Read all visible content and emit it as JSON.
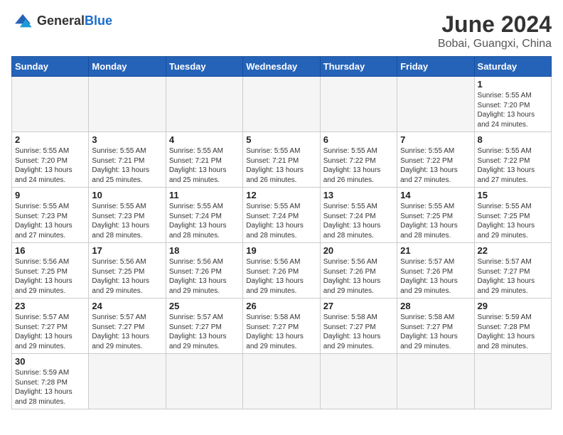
{
  "header": {
    "logo_general": "General",
    "logo_blue": "Blue",
    "month_title": "June 2024",
    "location": "Bobai, Guangxi, China"
  },
  "weekdays": [
    "Sunday",
    "Monday",
    "Tuesday",
    "Wednesday",
    "Thursday",
    "Friday",
    "Saturday"
  ],
  "days": [
    {
      "num": "",
      "sunrise": "",
      "sunset": "",
      "daylight": "",
      "empty": true
    },
    {
      "num": "",
      "sunrise": "",
      "sunset": "",
      "daylight": "",
      "empty": true
    },
    {
      "num": "",
      "sunrise": "",
      "sunset": "",
      "daylight": "",
      "empty": true
    },
    {
      "num": "",
      "sunrise": "",
      "sunset": "",
      "daylight": "",
      "empty": true
    },
    {
      "num": "",
      "sunrise": "",
      "sunset": "",
      "daylight": "",
      "empty": true
    },
    {
      "num": "",
      "sunrise": "",
      "sunset": "",
      "daylight": "",
      "empty": true
    },
    {
      "num": "1",
      "sunrise": "5:55 AM",
      "sunset": "7:20 PM",
      "daylight": "13 hours and 24 minutes.",
      "empty": false
    },
    {
      "num": "2",
      "sunrise": "5:55 AM",
      "sunset": "7:20 PM",
      "daylight": "13 hours and 24 minutes.",
      "empty": false
    },
    {
      "num": "3",
      "sunrise": "5:55 AM",
      "sunset": "7:21 PM",
      "daylight": "13 hours and 25 minutes.",
      "empty": false
    },
    {
      "num": "4",
      "sunrise": "5:55 AM",
      "sunset": "7:21 PM",
      "daylight": "13 hours and 25 minutes.",
      "empty": false
    },
    {
      "num": "5",
      "sunrise": "5:55 AM",
      "sunset": "7:21 PM",
      "daylight": "13 hours and 26 minutes.",
      "empty": false
    },
    {
      "num": "6",
      "sunrise": "5:55 AM",
      "sunset": "7:22 PM",
      "daylight": "13 hours and 26 minutes.",
      "empty": false
    },
    {
      "num": "7",
      "sunrise": "5:55 AM",
      "sunset": "7:22 PM",
      "daylight": "13 hours and 27 minutes.",
      "empty": false
    },
    {
      "num": "8",
      "sunrise": "5:55 AM",
      "sunset": "7:22 PM",
      "daylight": "13 hours and 27 minutes.",
      "empty": false
    },
    {
      "num": "9",
      "sunrise": "5:55 AM",
      "sunset": "7:23 PM",
      "daylight": "13 hours and 27 minutes.",
      "empty": false
    },
    {
      "num": "10",
      "sunrise": "5:55 AM",
      "sunset": "7:23 PM",
      "daylight": "13 hours and 28 minutes.",
      "empty": false
    },
    {
      "num": "11",
      "sunrise": "5:55 AM",
      "sunset": "7:24 PM",
      "daylight": "13 hours and 28 minutes.",
      "empty": false
    },
    {
      "num": "12",
      "sunrise": "5:55 AM",
      "sunset": "7:24 PM",
      "daylight": "13 hours and 28 minutes.",
      "empty": false
    },
    {
      "num": "13",
      "sunrise": "5:55 AM",
      "sunset": "7:24 PM",
      "daylight": "13 hours and 28 minutes.",
      "empty": false
    },
    {
      "num": "14",
      "sunrise": "5:55 AM",
      "sunset": "7:25 PM",
      "daylight": "13 hours and 28 minutes.",
      "empty": false
    },
    {
      "num": "15",
      "sunrise": "5:55 AM",
      "sunset": "7:25 PM",
      "daylight": "13 hours and 29 minutes.",
      "empty": false
    },
    {
      "num": "16",
      "sunrise": "5:56 AM",
      "sunset": "7:25 PM",
      "daylight": "13 hours and 29 minutes.",
      "empty": false
    },
    {
      "num": "17",
      "sunrise": "5:56 AM",
      "sunset": "7:25 PM",
      "daylight": "13 hours and 29 minutes.",
      "empty": false
    },
    {
      "num": "18",
      "sunrise": "5:56 AM",
      "sunset": "7:26 PM",
      "daylight": "13 hours and 29 minutes.",
      "empty": false
    },
    {
      "num": "19",
      "sunrise": "5:56 AM",
      "sunset": "7:26 PM",
      "daylight": "13 hours and 29 minutes.",
      "empty": false
    },
    {
      "num": "20",
      "sunrise": "5:56 AM",
      "sunset": "7:26 PM",
      "daylight": "13 hours and 29 minutes.",
      "empty": false
    },
    {
      "num": "21",
      "sunrise": "5:57 AM",
      "sunset": "7:26 PM",
      "daylight": "13 hours and 29 minutes.",
      "empty": false
    },
    {
      "num": "22",
      "sunrise": "5:57 AM",
      "sunset": "7:27 PM",
      "daylight": "13 hours and 29 minutes.",
      "empty": false
    },
    {
      "num": "23",
      "sunrise": "5:57 AM",
      "sunset": "7:27 PM",
      "daylight": "13 hours and 29 minutes.",
      "empty": false
    },
    {
      "num": "24",
      "sunrise": "5:57 AM",
      "sunset": "7:27 PM",
      "daylight": "13 hours and 29 minutes.",
      "empty": false
    },
    {
      "num": "25",
      "sunrise": "5:57 AM",
      "sunset": "7:27 PM",
      "daylight": "13 hours and 29 minutes.",
      "empty": false
    },
    {
      "num": "26",
      "sunrise": "5:58 AM",
      "sunset": "7:27 PM",
      "daylight": "13 hours and 29 minutes.",
      "empty": false
    },
    {
      "num": "27",
      "sunrise": "5:58 AM",
      "sunset": "7:27 PM",
      "daylight": "13 hours and 29 minutes.",
      "empty": false
    },
    {
      "num": "28",
      "sunrise": "5:58 AM",
      "sunset": "7:27 PM",
      "daylight": "13 hours and 29 minutes.",
      "empty": false
    },
    {
      "num": "29",
      "sunrise": "5:59 AM",
      "sunset": "7:28 PM",
      "daylight": "13 hours and 28 minutes.",
      "empty": false
    },
    {
      "num": "30",
      "sunrise": "5:59 AM",
      "sunset": "7:28 PM",
      "daylight": "13 hours and 28 minutes.",
      "empty": false
    },
    {
      "num": "",
      "sunrise": "",
      "sunset": "",
      "daylight": "",
      "empty": true
    },
    {
      "num": "",
      "sunrise": "",
      "sunset": "",
      "daylight": "",
      "empty": true
    },
    {
      "num": "",
      "sunrise": "",
      "sunset": "",
      "daylight": "",
      "empty": true
    },
    {
      "num": "",
      "sunrise": "",
      "sunset": "",
      "daylight": "",
      "empty": true
    },
    {
      "num": "",
      "sunrise": "",
      "sunset": "",
      "daylight": "",
      "empty": true
    },
    {
      "num": "",
      "sunrise": "",
      "sunset": "",
      "daylight": "",
      "empty": true
    }
  ],
  "labels": {
    "sunrise": "Sunrise:",
    "sunset": "Sunset:",
    "daylight": "Daylight:"
  }
}
